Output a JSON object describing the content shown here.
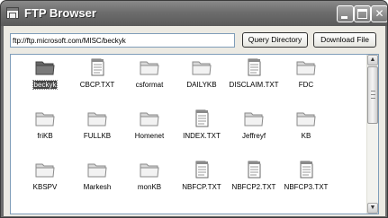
{
  "window": {
    "title": "FTP Browser"
  },
  "toolbar": {
    "url_value": "ftp://ftp.microsoft.com/MISC/beckyk",
    "query_label": "Query Directory",
    "download_label": "Download File"
  },
  "items": [
    {
      "label": "beckyk",
      "type": "folder",
      "selected": true
    },
    {
      "label": "CBCP.TXT",
      "type": "file"
    },
    {
      "label": "csformat",
      "type": "folder"
    },
    {
      "label": "DAILYKB",
      "type": "folder"
    },
    {
      "label": "DISCLAIM.TXT",
      "type": "file"
    },
    {
      "label": "FDC",
      "type": "folder"
    },
    {
      "label": "friKB",
      "type": "folder"
    },
    {
      "label": "FULLKB",
      "type": "folder"
    },
    {
      "label": "Homenet",
      "type": "folder"
    },
    {
      "label": "INDEX.TXT",
      "type": "file"
    },
    {
      "label": "Jeffreyf",
      "type": "folder"
    },
    {
      "label": "KB",
      "type": "folder"
    },
    {
      "label": "KBSPV",
      "type": "folder"
    },
    {
      "label": "Markesh",
      "type": "folder"
    },
    {
      "label": "monKB",
      "type": "folder"
    },
    {
      "label": "NBFCP.TXT",
      "type": "file"
    },
    {
      "label": "NBFCP2.TXT",
      "type": "file"
    },
    {
      "label": "NBFCP3.TXT",
      "type": "file"
    }
  ],
  "icons": {
    "minimize": "minimize-icon",
    "maximize": "maximize-icon",
    "close": "close-icon",
    "folder": "folder-icon",
    "file": "text-file-icon"
  }
}
